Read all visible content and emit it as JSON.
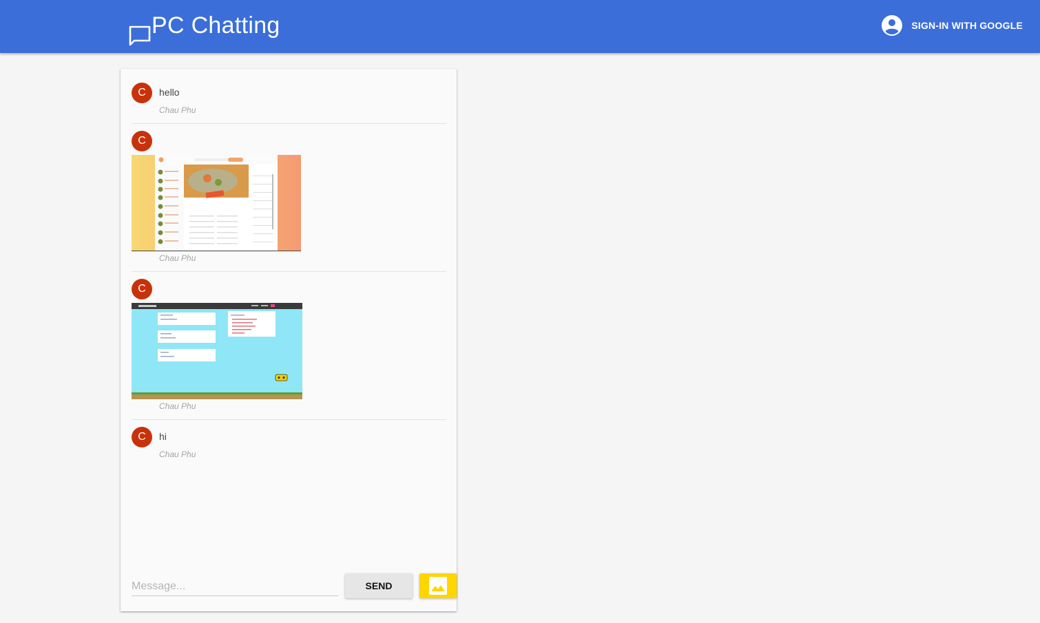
{
  "header": {
    "title": "PC Chatting",
    "brand_icon": "chat-bubble-icon",
    "signin_label": "SIGN-IN WITH GOOGLE",
    "signin_icon": "account-circle-icon",
    "background": "#3b6ed9"
  },
  "messages": [
    {
      "avatar_letter": "C",
      "text": "hello",
      "author": "Chau Phu"
    },
    {
      "avatar_letter": "C",
      "image": "recipe-app-screenshot",
      "author": "Chau Phu"
    },
    {
      "avatar_letter": "C",
      "image": "game-app-screenshot",
      "author": "Chau Phu"
    },
    {
      "avatar_letter": "C",
      "text": "hi",
      "author": "Chau Phu"
    }
  ],
  "composer": {
    "placeholder": "Message...",
    "send_label": "SEND",
    "image_button_icon": "image-icon",
    "send_color": "#e6e6e6",
    "image_button_color": "#ffd500"
  },
  "colors": {
    "avatar": "#c8320b",
    "page_background": "#f5f5f5"
  }
}
